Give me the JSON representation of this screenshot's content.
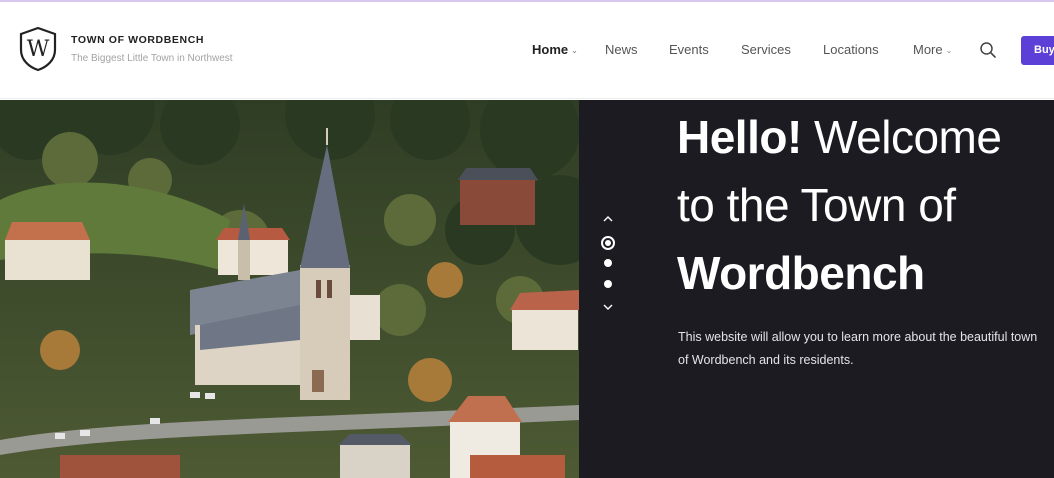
{
  "header": {
    "brand_name": "TOWN OF WORDBENCH",
    "tagline": "The Biggest Little Town in Northwest",
    "logo_letter": "W"
  },
  "nav": {
    "items": [
      {
        "label": "Home",
        "active": true,
        "has_dropdown": true
      },
      {
        "label": "News",
        "active": false,
        "has_dropdown": false
      },
      {
        "label": "Events",
        "active": false,
        "has_dropdown": false
      },
      {
        "label": "Services",
        "active": false,
        "has_dropdown": false
      },
      {
        "label": "Locations",
        "active": false,
        "has_dropdown": false
      },
      {
        "label": "More",
        "active": false,
        "has_dropdown": true
      }
    ],
    "dropdown_caret": "⌄",
    "search_icon": "search-icon",
    "cta_label": "Buy"
  },
  "hero": {
    "title_line1_bold": "Hello!",
    "title_line1_rest": " Welcome",
    "title_line2": "to the Town of",
    "title_line3_bold": "Wordbench",
    "description": "This website will allow you to learn more about the beautiful town of Wordbench and its residents.",
    "slides_total": 3,
    "active_slide": 1
  },
  "colors": {
    "accent": "#5b3fd6",
    "hero_panel": "#1c1b22",
    "text_dark": "#222222",
    "text_muted": "#a3a3a3"
  }
}
